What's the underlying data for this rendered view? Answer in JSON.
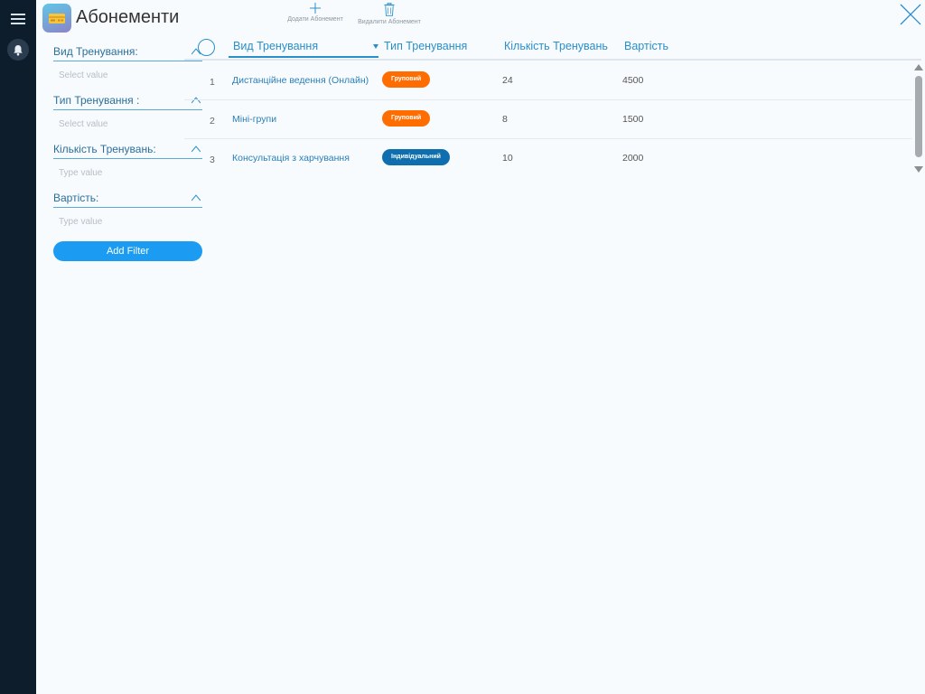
{
  "header": {
    "title": "Абонементи",
    "add_label": "Додати Абонемент",
    "delete_label": "Видалити Абонемент"
  },
  "filters": [
    {
      "label": "Вид Тренування:",
      "placeholder": "Select value",
      "icon": "chevron-up-icon"
    },
    {
      "label": "Тип Тренування :",
      "placeholder": "Select value",
      "icon": "chevron-up-icon"
    },
    {
      "label": "Кількість Тренувань:",
      "placeholder": "Type value",
      "icon": "chevron-up-icon"
    },
    {
      "label": "Вартість:",
      "placeholder": "Type value",
      "icon": "chevron-up-icon"
    }
  ],
  "add_filter_label": "Add Filter",
  "table": {
    "columns": [
      "Вид Тренування",
      "Тип Тренування",
      "Кількість Тренувань",
      "Вартість"
    ],
    "rows": [
      {
        "num": "1",
        "name": "Дистанційне ведення (Онлайн)",
        "type": "Груповий",
        "type_color": "#ff6d00",
        "count": "24",
        "price": "4500"
      },
      {
        "num": "2",
        "name": "Міні-групи",
        "type": "Груповий",
        "type_color": "#ff6d00",
        "count": "8",
        "price": "1500"
      },
      {
        "num": "3",
        "name": "Консультація з харчування",
        "type": "Індивідуальний",
        "type_color": "#0f6fae",
        "count": "10",
        "price": "2000"
      }
    ]
  },
  "colors": {
    "accent": "#2a8fc9",
    "button": "#1b9cf2",
    "rail": "#0d1d2c",
    "badge_group": "#ff6d00",
    "badge_individual": "#0f6fae"
  },
  "icons": {
    "menu": "hamburger-menu-icon",
    "notifications": "bell-icon",
    "logo": "subscription-card-icon",
    "add": "plus-icon",
    "delete": "trash-icon",
    "close": "close-icon",
    "search": "search-icon"
  }
}
